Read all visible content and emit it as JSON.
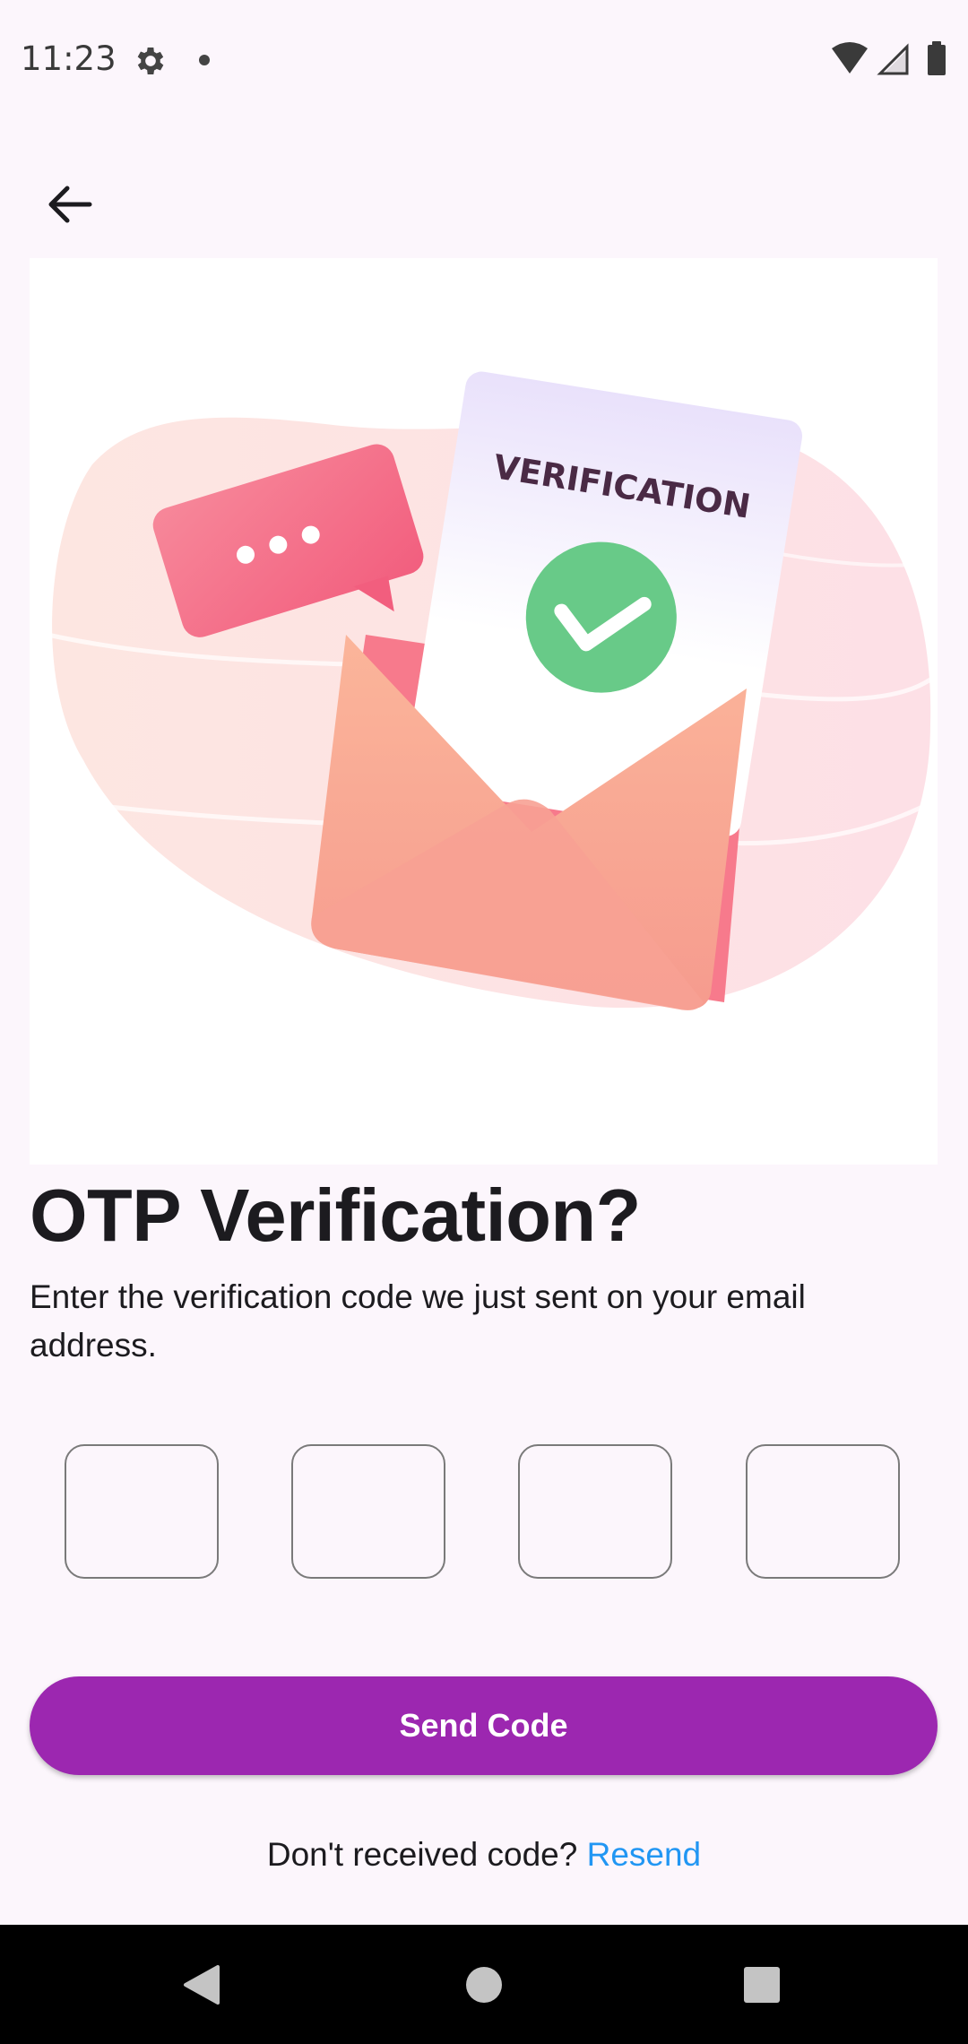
{
  "status_bar": {
    "time": "11:23",
    "icons": [
      "gear-icon",
      "notification-dot-icon",
      "wifi-icon",
      "signal-icon",
      "battery-icon"
    ]
  },
  "header": {
    "back_icon": "arrow-back-icon"
  },
  "hero": {
    "card_text": "VERIFICATION",
    "colors": {
      "blob": "#fde3e0",
      "envelope": "#f9a98f",
      "bubble": "#f46b8a",
      "check": "#5dc47f"
    }
  },
  "main": {
    "title": "OTP Verification?",
    "subtitle": "Enter the verification code we just sent on your email address.",
    "otp_fields": [
      "",
      "",
      "",
      ""
    ],
    "send_button_label": "Send Code",
    "resend_prompt": "Don't received code?",
    "resend_link": "Resend"
  },
  "colors": {
    "background": "#fcf6fc",
    "primary": "#9c27b0",
    "link": "#2196f3"
  },
  "nav_bar": {
    "icons": [
      "back-triangle-icon",
      "home-circle-icon",
      "recents-square-icon"
    ]
  }
}
